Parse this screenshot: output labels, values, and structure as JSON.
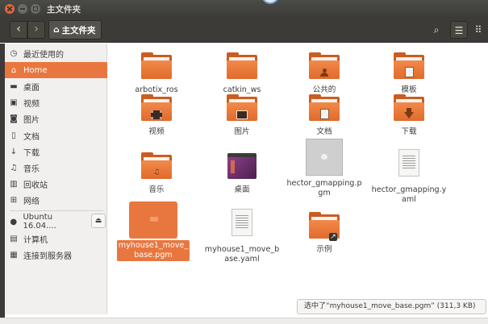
{
  "window": {
    "title": "主文件夹"
  },
  "toolbar": {
    "back": "‹",
    "forward": "›",
    "path_label": "主文件夹",
    "home_glyph": "⌂",
    "search_glyph": "⌕",
    "list_glyph": "☰",
    "grid_glyph": "⠿"
  },
  "sidebar": {
    "items": [
      {
        "label": "最近使用的",
        "icon": "clock-icon",
        "glyph": "◷"
      },
      {
        "label": "Home",
        "icon": "home-icon",
        "glyph": "⌂"
      },
      {
        "label": "桌面",
        "icon": "desktop-icon",
        "glyph": "▬"
      },
      {
        "label": "视频",
        "icon": "video-icon",
        "glyph": "▣"
      },
      {
        "label": "图片",
        "icon": "camera-icon",
        "glyph": "◙"
      },
      {
        "label": "文档",
        "icon": "document-icon",
        "glyph": "▯"
      },
      {
        "label": "下载",
        "icon": "download-icon",
        "glyph": "↓"
      },
      {
        "label": "音乐",
        "icon": "music-icon",
        "glyph": "♫"
      },
      {
        "label": "回收站",
        "icon": "trash-icon",
        "glyph": "▥"
      },
      {
        "label": "网络",
        "icon": "network-icon",
        "glyph": "⊞"
      },
      {
        "label": "Ubuntu 16.04....",
        "icon": "disk-icon",
        "glyph": "●"
      },
      {
        "label": "计算机",
        "icon": "computer-icon",
        "glyph": "▤"
      },
      {
        "label": "连接到服务器",
        "icon": "server-icon",
        "glyph": "▦"
      }
    ],
    "eject_glyph": "⏏"
  },
  "files": [
    {
      "name": "arbotix_ros",
      "type": "folder"
    },
    {
      "name": "catkin_ws",
      "type": "folder"
    },
    {
      "name": "公共的",
      "type": "folder-public"
    },
    {
      "name": "模板",
      "type": "folder-templates"
    },
    {
      "name": "视频",
      "type": "folder-videos"
    },
    {
      "name": "图片",
      "type": "folder-pictures"
    },
    {
      "name": "文档",
      "type": "folder-documents"
    },
    {
      "name": "下载",
      "type": "folder-downloads"
    },
    {
      "name": "音乐",
      "type": "folder-music"
    },
    {
      "name": "桌面",
      "type": "folder-desktop"
    },
    {
      "name": "hector_gmapping.pgm",
      "type": "image-file"
    },
    {
      "name": "hector_gmapping.yaml",
      "type": "text-file"
    },
    {
      "name": "myhouse1_move_base.pgm",
      "type": "image-file",
      "selected": true
    },
    {
      "name": "myhouse1_move_base.yaml",
      "type": "text-file"
    },
    {
      "name": "示例",
      "type": "folder-link"
    }
  ],
  "status": {
    "text": "选中了“myhouse1_move_base.pgm” (311,3 KB)"
  },
  "colors": {
    "accent": "#e8773f",
    "folder": "#f28a4a",
    "titlebar": "#3c3b37"
  }
}
